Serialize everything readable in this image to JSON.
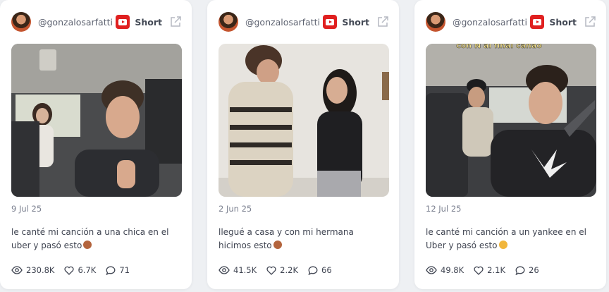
{
  "cards": [
    {
      "handle": "@gonzalosarfatti",
      "kind": "Short",
      "date": "9 Jul 25",
      "caption": "le canté mi canción a una chica en el uber y pasó esto",
      "emoji": "see-no-evil-monkey",
      "views": "230.8K",
      "likes": "6.7K",
      "comments": "71"
    },
    {
      "handle": "@gonzalosarfatti",
      "kind": "Short",
      "date": "2 Jun 25",
      "caption": "llegué a casa y con mi hermana hicimos esto",
      "emoji": "see-no-evil-monkey",
      "views": "41.5K",
      "likes": "2.2K",
      "comments": "66"
    },
    {
      "handle": "@gonzalosarfatti",
      "kind": "Short",
      "date": "12 Jul 25",
      "caption": "le canté mi canción a un yankee en el Uber y pasó esto",
      "emoji": "weary-face",
      "views": "49.8K",
      "likes": "2.1K",
      "comments": "26"
    }
  ],
  "thumb3_overlay_text": "con N al final cañao",
  "colors": {
    "youtube_red": "#e02020",
    "text_muted": "#7c8190",
    "text_main": "#3f4451"
  }
}
